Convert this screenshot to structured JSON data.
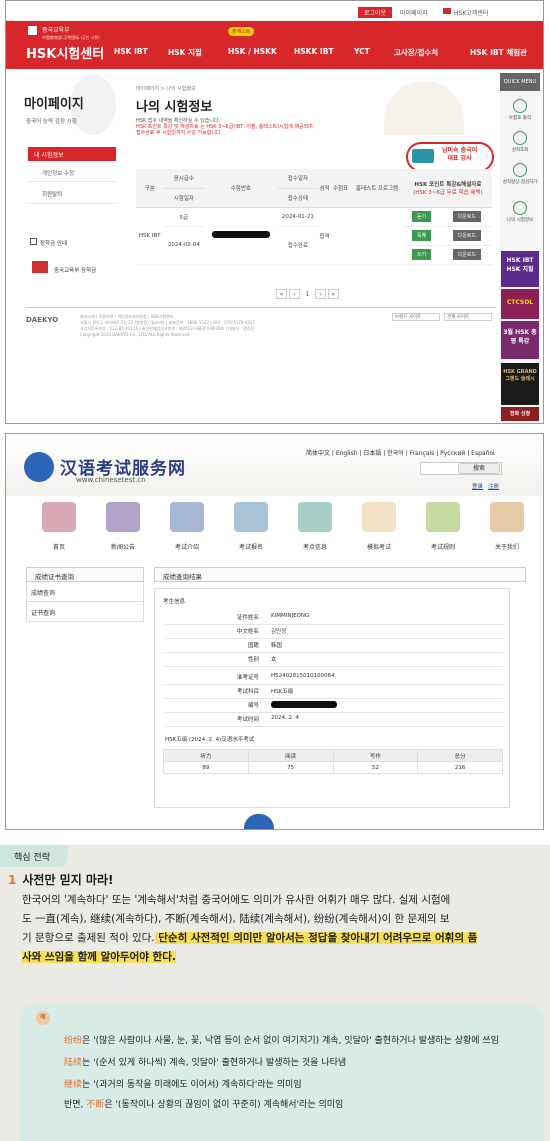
{
  "panel1": {
    "top_bar": {
      "login": "로그아웃",
      "mypage": "마이페이지",
      "lang": "HSK고객센터"
    },
    "logo": {
      "org": "중국교육부",
      "org_sub": "中国教育部 汉考国际 (공인 시행)",
      "name": "HSK시험센터"
    },
    "nav": [
      "HSK IBT",
      "HSK 지필",
      "HSK / HSKK",
      "HSKK IBT",
      "YCT",
      "고사장/접수처",
      "HSK IBT 체험관"
    ],
    "nav_badge": "출제스트",
    "sidebar": {
      "title": "마이페이지",
      "subtitle": "중국어 능력 검정 시험",
      "active": "내 시험정보",
      "links": [
        "개인정보 수정",
        "회원탈퇴"
      ],
      "extra": [
        {
          "label": "장학금 안내"
        },
        {
          "label": "중국교육부 장학금"
        }
      ]
    },
    "breadcrumb": "마이페이지   >   나의 시험정보",
    "title": "나의 시험정보",
    "desc_1": "HSK 접수 내역을 확인하실 수 있습니다.",
    "desc_2": "HSK 포인트 특강 및 해설자료 는 HSK 3~6급(IBT, 지필, 홈테스트)시험에 제공되며",
    "desc_3": "접수완료 후 시험일까지 수강 가능합니다.",
    "banner": {
      "line1": "남미숙 중국어",
      "line2": "대표 강사"
    },
    "table": {
      "headers": {
        "type": "구분",
        "level": "응시급수",
        "date": "시험일자",
        "number": "수험번호",
        "reg_date": "접수일자",
        "status": "접수상태",
        "score": "성적",
        "report": "수험표",
        "hometest": "홈테스트 프로그램",
        "lecture": "HSK 포인트 특강&해설자료",
        "lecture_sub": "(HSK 3~6급 무료 학습 혜택)"
      },
      "row": {
        "type": "HSK IBT",
        "level": "5급",
        "date": "2024-02-04",
        "reg_date": "2024-01-21",
        "status": "접수완료",
        "score": "합격"
      },
      "actions": [
        {
          "btn": "듣기",
          "download": "다운로드"
        },
        {
          "btn": "독해",
          "download": "다운로드"
        },
        {
          "btn": "쓰기",
          "download": "다운로드"
        }
      ]
    },
    "pager": [
      "«",
      "‹",
      "1",
      "›",
      "»"
    ],
    "footer": {
      "brand": "DAEKYO",
      "lines": [
        "회사소개 | 이용약관 | 개인정보처리방침 | HSK시험센터",
        "서울시 관악구 보라매로 3길 23 (봉천동) 대교타워 | 대표전화 : 1666-1522 | FAX : 070-4170-4317",
        "사업자등록번호 : 112-81-41116 | 통신판매업신고번호 : 제2013-서울관악-0678호 | 대표자 : 강호준",
        "Copyright 2013 DAEKYO Co., LTD. ALL Rights Reserved."
      ],
      "select1": "브랜드 사이트",
      "select2": "관계 사이트"
    },
    "quick_menu": {
      "title": "QUICK MENU",
      "items": [
        "수험표 출력",
        "성적조회",
        "성적향상 점검하기",
        "나의 시험정보"
      ],
      "ads": [
        "HSK IBT HSK 지필",
        "CTCSOL",
        "3월 HSK 총평 특강",
        "HSK GRAND 그랜드 슬래시",
        "전화 신청"
      ]
    }
  },
  "panel2": {
    "site_title": "汉语考试服务网",
    "url": "www.chinesetest.cn",
    "languages": "简体中文 | English | 日本語 | 한국어 | Français | Русский | Español",
    "search_btn": "搜索",
    "login": "登录",
    "register": "注册",
    "nav": [
      "首页",
      "新闻公告",
      "考试介绍",
      "考试报名",
      "考点信息",
      "模拟考试",
      "考试规则",
      "关于我们"
    ],
    "left": {
      "title": "成绩证书查询",
      "items": [
        "成绩查询",
        "证书查询"
      ]
    },
    "right_title": "成绩查询结果",
    "info_title": "考生信息",
    "info": [
      {
        "k": "证件姓名",
        "v": "KIMMINJEONG"
      },
      {
        "k": "中文姓名",
        "v": "김민정"
      },
      {
        "k": "国籍",
        "v": "韩国"
      },
      {
        "k": "性别",
        "v": "女"
      },
      {
        "k": "准考证号",
        "v": "H52402815010100064"
      },
      {
        "k": "考试科目",
        "v": "HSK五级"
      },
      {
        "k": "编号",
        "v": ""
      },
      {
        "k": "考试时间",
        "v": "2024. 2. 4"
      }
    ],
    "score_title": "HSK五级 (2024. 2. 4)汉语水平考试",
    "score_headers": [
      "听力",
      "阅读",
      "写作",
      "总分"
    ],
    "scores": [
      "89",
      "75",
      "52",
      "216"
    ]
  },
  "panel3": {
    "tag": "핵심 전략",
    "heading_num": "1",
    "heading": "사전만 믿지 마라!",
    "para_1": "한국어의 '계속하다' 또는 '계속해서'처럼 중국어에도 의미가 유사한 어휘가 매우 많다. 실제 시험에",
    "para_2": "도 一直(계속), 继续(계속하다), 不断(계속해서), 陆续(계속해서), 纷纷(계속해서)이 한 문제의 보",
    "para_3a": "기 문항으로 출제된 적이 있다.",
    "para_3b": " 단순히 사전적인 의미만 알아서는 정답을 찾아내기 어려우므로 어휘의 품",
    "para_4": "사와 쓰임을 함께 알아두어야 한다.",
    "box_badge": "예",
    "lines": [
      {
        "w": "纷纷",
        "t": "은 '(많은 사람이나 사물, 눈, 꽃, 낙엽 등이 순서 없이 여기저기) 계속, 잇달아' 출현하거나 발생하는 상황에 쓰임"
      },
      {
        "w": "陆续",
        "t": "는 '(순서 있게 하나씩) 계속, 잇달아' 출현하거나 발생하는 것을 나타냄"
      },
      {
        "w": "继续",
        "t": "는 '(과거의 동작을 미래에도 이어서) 계속하다'라는 의미임"
      },
      {
        "w": "",
        "pre": "반면, ",
        "w2": "不断",
        "t": "은 '(동작이나 상황의 끊임이 없이 꾸준히) 계속해서'라는 의미임"
      }
    ]
  }
}
